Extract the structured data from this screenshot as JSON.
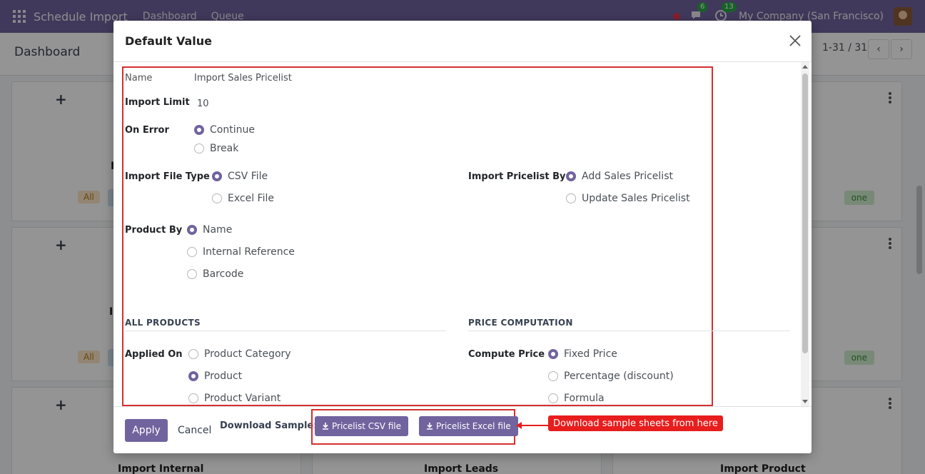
{
  "navbar": {
    "app_title": "Schedule Import",
    "menu": [
      "Dashboard",
      "Queue"
    ],
    "messages_count": "6",
    "activities_count": "13",
    "company": "My Company (San Francisco)"
  },
  "control_panel": {
    "title": "Dashboard",
    "pager": "1-31 / 31"
  },
  "background_cards": {
    "tag_all": "All",
    "tag_done": "one",
    "card_titles": [
      "Import Internal",
      "Import Leads",
      "Import Product"
    ],
    "peek_letters": [
      "I",
      "I"
    ]
  },
  "modal": {
    "title": "Default Value",
    "fields": {
      "name_label": "Name",
      "name_value": "Import Sales Pricelist",
      "import_limit_label": "Import Limit",
      "import_limit_value": "10",
      "on_error_label": "On Error",
      "on_error_options": [
        "Continue",
        "Break"
      ],
      "on_error_selected": "Continue",
      "import_file_type_label": "Import File Type",
      "import_file_type_options": [
        "CSV File",
        "Excel File"
      ],
      "import_file_type_selected": "CSV File",
      "import_pricelist_by_label": "Import Pricelist By",
      "import_pricelist_by_options": [
        "Add Sales Pricelist",
        "Update Sales Pricelist"
      ],
      "import_pricelist_by_selected": "Add Sales Pricelist",
      "product_by_label": "Product By",
      "product_by_options": [
        "Name",
        "Internal Reference",
        "Barcode"
      ],
      "product_by_selected": "Name"
    },
    "sections": {
      "all_products": "ALL PRODUCTS",
      "price_computation": "PRICE COMPUTATION"
    },
    "applied_on_label": "Applied On",
    "applied_on_options": [
      "Product Category",
      "Product",
      "Product Variant"
    ],
    "applied_on_selected": "Product",
    "compute_price_label": "Compute Price",
    "compute_price_options": [
      "Fixed Price",
      "Percentage (discount)",
      "Formula"
    ],
    "compute_price_selected": "Fixed Price",
    "footer": {
      "apply_label": "Apply",
      "cancel_label": "Cancel",
      "download_label": "Download Sample:",
      "csv_button": "Pricelist CSV file",
      "excel_button": "Pricelist Excel file"
    }
  },
  "annotation": {
    "callout_text": "Download sample sheets from here"
  },
  "colors": {
    "brand": "#71639e",
    "annotation_red": "#e81d1d"
  },
  "icons": [
    "apps-grid-icon",
    "status-dot-icon",
    "chat-icon",
    "clock-icon",
    "avatar",
    "chevron-left-icon",
    "chevron-right-icon",
    "plus-icon",
    "kebab-icon",
    "close-icon",
    "download-icon"
  ]
}
